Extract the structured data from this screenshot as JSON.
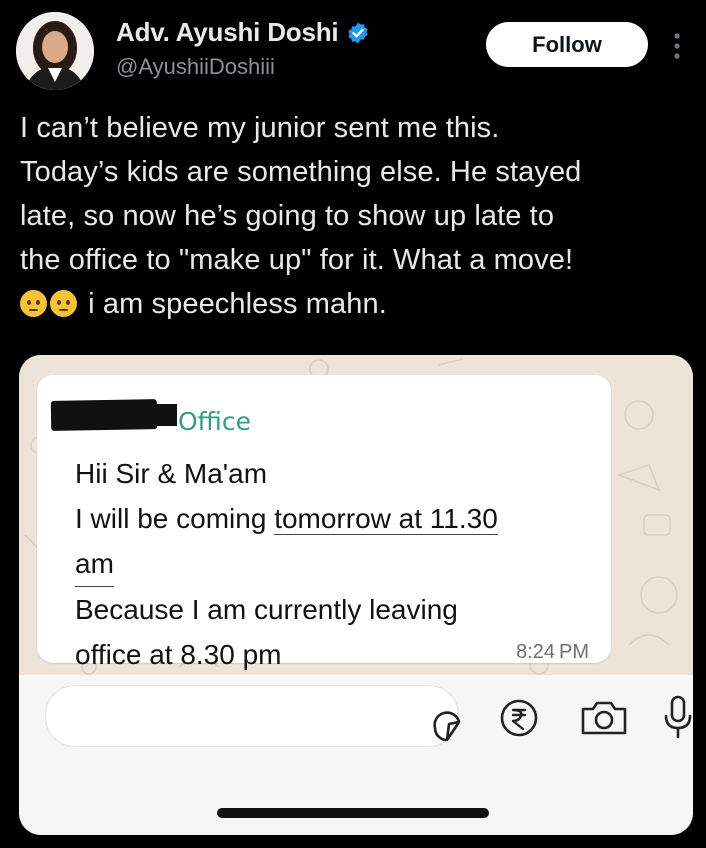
{
  "author": {
    "name": "Adv. Ayushi Doshi",
    "handle": "@AyushiiDoshiii",
    "verified": true
  },
  "actions": {
    "follow_label": "Follow"
  },
  "tweet": {
    "lines": [
      "I can’t believe my junior sent me this.",
      "Today’s kids are something else. He stayed",
      "late, so now he’s going to show up late to",
      "the office to \"make up\" for it. What a move!"
    ],
    "last_line": "i am speechless mahn.",
    "emojis": [
      "face-with-raised-eyebrow",
      "face-with-raised-eyebrow"
    ]
  },
  "screenshot": {
    "sender_suffix": "Office",
    "message_lines": [
      "Hii Sir & Ma'am",
      "I will be coming ",
      "tomorrow at 11.30",
      "am",
      "Because I am currently leaving",
      "office at 8.30 pm"
    ],
    "time": "8:24 PM"
  },
  "colors": {
    "background": "#000000",
    "sender_green": "#2f9e83",
    "verified_blue": "#1d9bf0"
  },
  "icons": [
    "verified-badge-icon",
    "more-vertical-icon",
    "sticker-icon",
    "rupee-icon",
    "camera-icon",
    "microphone-icon"
  ]
}
